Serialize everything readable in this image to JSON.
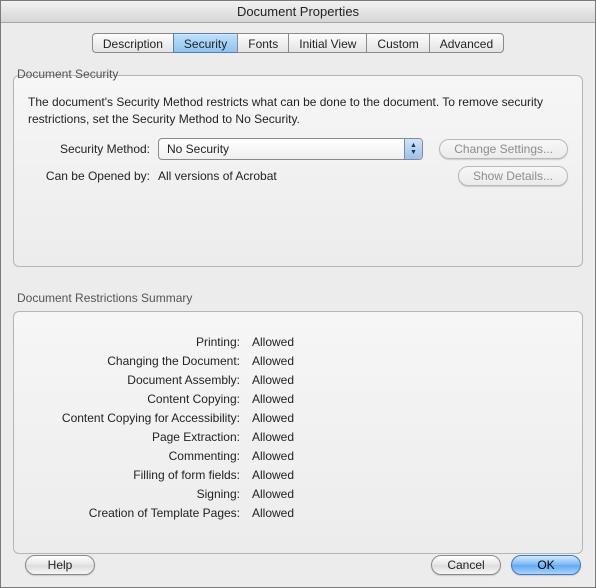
{
  "window": {
    "title": "Document Properties"
  },
  "tabs": [
    {
      "label": "Description"
    },
    {
      "label": "Security"
    },
    {
      "label": "Fonts"
    },
    {
      "label": "Initial View"
    },
    {
      "label": "Custom"
    },
    {
      "label": "Advanced"
    }
  ],
  "security": {
    "group_label": "Document Security",
    "description": "The document's Security Method restricts what can be done to the document. To remove security restrictions, set the Security Method to No Security.",
    "method_label": "Security Method:",
    "method_value": "No Security",
    "change_settings_label": "Change Settings...",
    "opened_by_label": "Can be Opened by:",
    "opened_by_value": "All versions of Acrobat",
    "show_details_label": "Show Details..."
  },
  "restrictions": {
    "group_label": "Document Restrictions Summary",
    "items": [
      {
        "k": "Printing:",
        "v": "Allowed"
      },
      {
        "k": "Changing the Document:",
        "v": "Allowed"
      },
      {
        "k": "Document Assembly:",
        "v": "Allowed"
      },
      {
        "k": "Content Copying:",
        "v": "Allowed"
      },
      {
        "k": "Content Copying for Accessibility:",
        "v": "Allowed"
      },
      {
        "k": "Page Extraction:",
        "v": "Allowed"
      },
      {
        "k": "Commenting:",
        "v": "Allowed"
      },
      {
        "k": "Filling of form fields:",
        "v": "Allowed"
      },
      {
        "k": "Signing:",
        "v": "Allowed"
      },
      {
        "k": "Creation of Template Pages:",
        "v": "Allowed"
      }
    ]
  },
  "footer": {
    "help": "Help",
    "cancel": "Cancel",
    "ok": "OK"
  }
}
